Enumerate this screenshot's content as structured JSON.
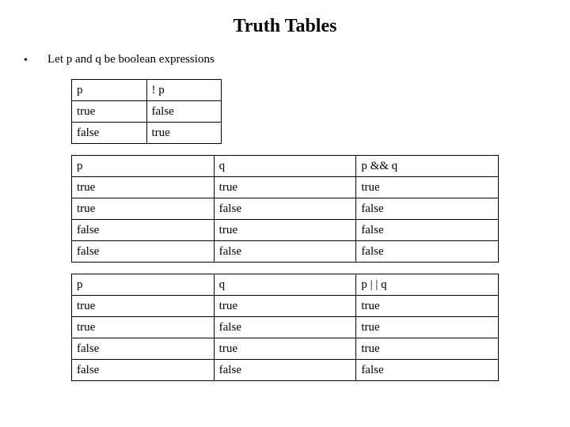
{
  "title": "Truth Tables",
  "bullet_text": "Let p and q be boolean expressions",
  "table_not": {
    "headers": [
      "p",
      "! p"
    ],
    "rows": [
      [
        "true",
        "false"
      ],
      [
        "false",
        "true"
      ]
    ]
  },
  "table_and": {
    "headers": [
      "p",
      "q",
      "p && q"
    ],
    "rows": [
      [
        "true",
        "true",
        "true"
      ],
      [
        "true",
        "false",
        "false"
      ],
      [
        "false",
        "true",
        "false"
      ],
      [
        "false",
        "false",
        "false"
      ]
    ]
  },
  "table_or": {
    "headers": [
      "p",
      "q",
      "p | | q"
    ],
    "rows": [
      [
        "true",
        "true",
        "true"
      ],
      [
        "true",
        "false",
        "true"
      ],
      [
        "false",
        "true",
        "true"
      ],
      [
        "false",
        "false",
        "false"
      ]
    ]
  }
}
